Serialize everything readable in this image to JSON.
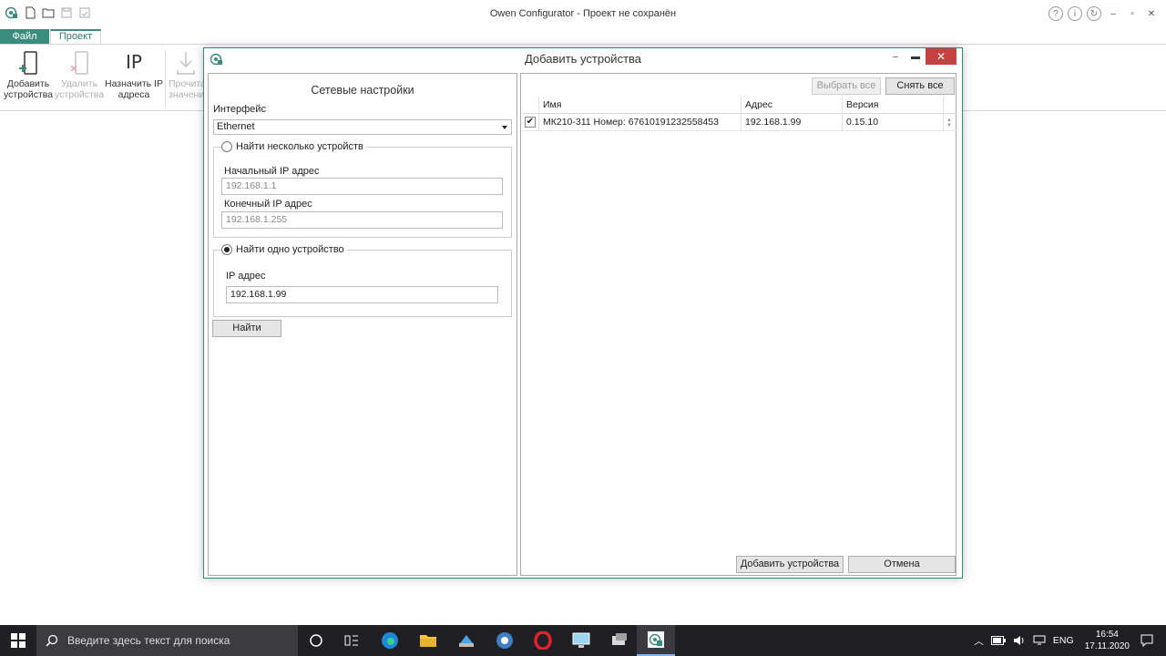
{
  "app": {
    "title": "Owen Configurator - Проект не сохранён"
  },
  "ribbon": {
    "tabs": {
      "file": "Файл",
      "project": "Проект"
    },
    "buttons": {
      "add": {
        "line1": "Добавить",
        "line2": "устройства"
      },
      "remove": {
        "line1": "Удалить",
        "line2": "устройства"
      },
      "assign_ip": {
        "icon_text": "IP",
        "line1": "Назначить IP",
        "line2": "адреса"
      },
      "read": {
        "line1": "Прочита",
        "line2": "значени"
      }
    }
  },
  "dialog": {
    "title": "Добавить устройства",
    "left": {
      "heading": "Сетевые настройки",
      "interface_label": "Интерфейс",
      "interface_value": "Ethernet",
      "multi": {
        "label": "Найти несколько устройств",
        "start_ip_label": "Начальный IP адрес",
        "start_ip_placeholder": "192.168.1.1",
        "end_ip_label": "Конечный IP адрес",
        "end_ip_placeholder": "192.168.1.255"
      },
      "single": {
        "label": "Найти одно устройство",
        "ip_label": "IP адрес",
        "ip_value": "192.168.1.99"
      },
      "find_button": "Найти"
    },
    "right": {
      "select_all": "Выбрать все",
      "deselect_all": "Снять все",
      "columns": {
        "name": "Имя",
        "address": "Адрес",
        "version": "Версия"
      },
      "rows": [
        {
          "name": "МК210-311 Номер: 67610191232558453",
          "address": "192.168.1.99",
          "version": "0.15.10"
        }
      ],
      "add_button": "Добавить устройства",
      "cancel_button": "Отмена"
    }
  },
  "taskbar": {
    "search_placeholder": "Введите здесь текст для поиска",
    "language": "ENG",
    "time": "16:54",
    "date": "17.11.2020"
  },
  "colors": {
    "accent": "#3a8c7c",
    "close": "#c74343",
    "taskbar": "#1f1f24"
  }
}
